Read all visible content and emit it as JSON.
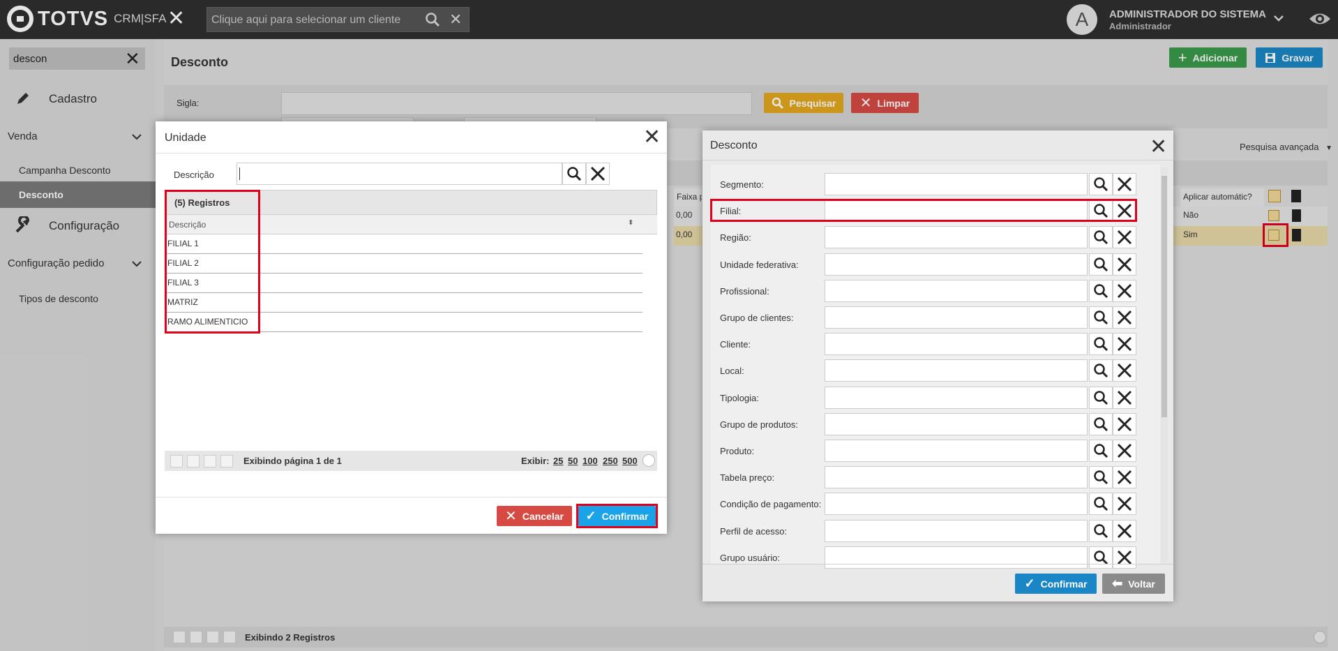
{
  "topbar": {
    "brand": "TOTVS",
    "product": "CRM|SFA",
    "client_placeholder": "Clique aqui para selecionar um cliente",
    "avatar_letter": "A",
    "user_name": "ADMINISTRADOR DO SISTEMA",
    "user_role": "Administrador"
  },
  "sidebar": {
    "search_value": "descon",
    "items": [
      {
        "label": "Cadastro"
      },
      {
        "label": "Venda"
      },
      {
        "label": "Campanha Desconto"
      },
      {
        "label": "Desconto"
      },
      {
        "label": "Configuração"
      },
      {
        "label": "Configuração pedido"
      },
      {
        "label": "Tipos de desconto"
      }
    ]
  },
  "main": {
    "title": "Desconto",
    "add_label": "Adicionar",
    "save_label": "Gravar",
    "sigla_label": "Sigla:",
    "search_label": "Pesquisar",
    "clear_label": "Limpar",
    "advanced_search": "Pesquisa avançada",
    "col_faixa": "Faixa p",
    "col_aplicar": "Aplicar automátic?",
    "rows": [
      {
        "faixa": "0,00",
        "aplicar": "Não"
      },
      {
        "faixa": "0,00",
        "aplicar": "Sim"
      }
    ],
    "footer_text": "Exibindo 2 Registros"
  },
  "unidade_dialog": {
    "title": "Unidade",
    "descricao_label": "Descrição",
    "search_value": "",
    "records_label": "(5) Registros",
    "column_header": "Descrição",
    "rows": [
      "FILIAL 1",
      "FILIAL 2",
      "FILIAL 3",
      "MATRIZ",
      "RAMO ALIMENTICIO"
    ],
    "page_info": "Exibindo página 1 de 1",
    "show_label": "Exibir:",
    "page_sizes": [
      "25",
      "50",
      "100",
      "250",
      "500"
    ],
    "cancel_label": "Cancelar",
    "confirm_label": "Confirmar"
  },
  "desconto_dialog": {
    "title": "Desconto",
    "fields": [
      "Segmento:",
      "Filial:",
      "Região:",
      "Unidade federativa:",
      "Profissional:",
      "Grupo de clientes:",
      "Cliente:",
      "Local:",
      "Tipologia:",
      "Grupo de produtos:",
      "Produto:",
      "Tabela preço:",
      "Condição de pagamento:",
      "Perfil de acesso:",
      "Grupo usuário:"
    ],
    "confirm_label": "Confirmar",
    "back_label": "Voltar"
  },
  "colors": {
    "topbar": "#2f2f2f",
    "green": "#3a9a4a",
    "blue": "#1b86c5",
    "confirm_blue": "#1aa3e8",
    "yellow": "#e3a81e",
    "red": "#d64a43",
    "highlight": "#e3001b"
  }
}
